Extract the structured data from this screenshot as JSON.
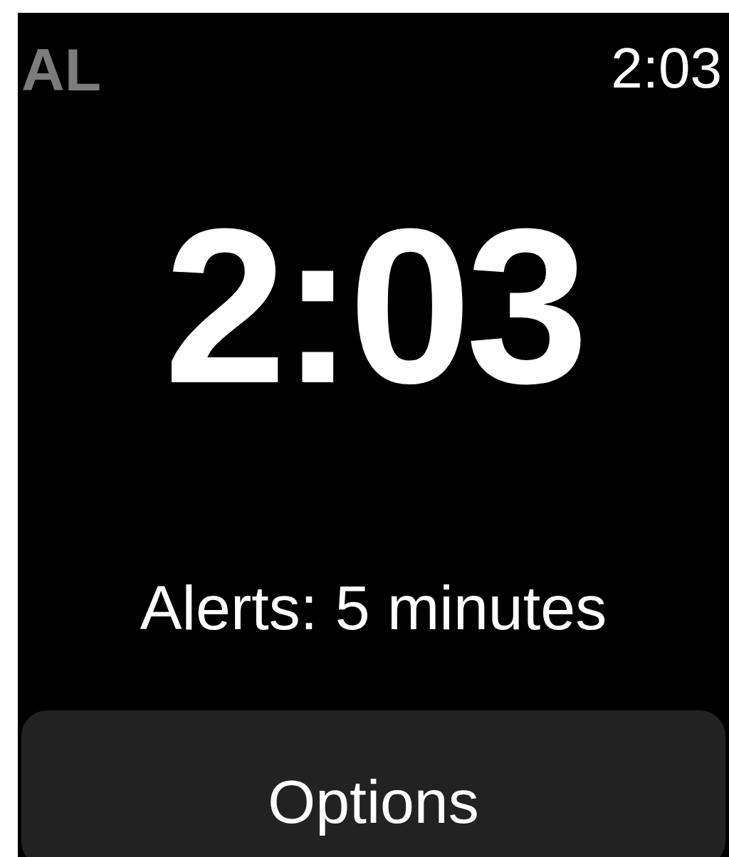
{
  "status_bar": {
    "app_label": "AL",
    "time": "2:03"
  },
  "timer": {
    "time": "2:03"
  },
  "alerts": "Alerts: 5 minutes",
  "buttons": [
    {
      "label": "Options"
    }
  ]
}
